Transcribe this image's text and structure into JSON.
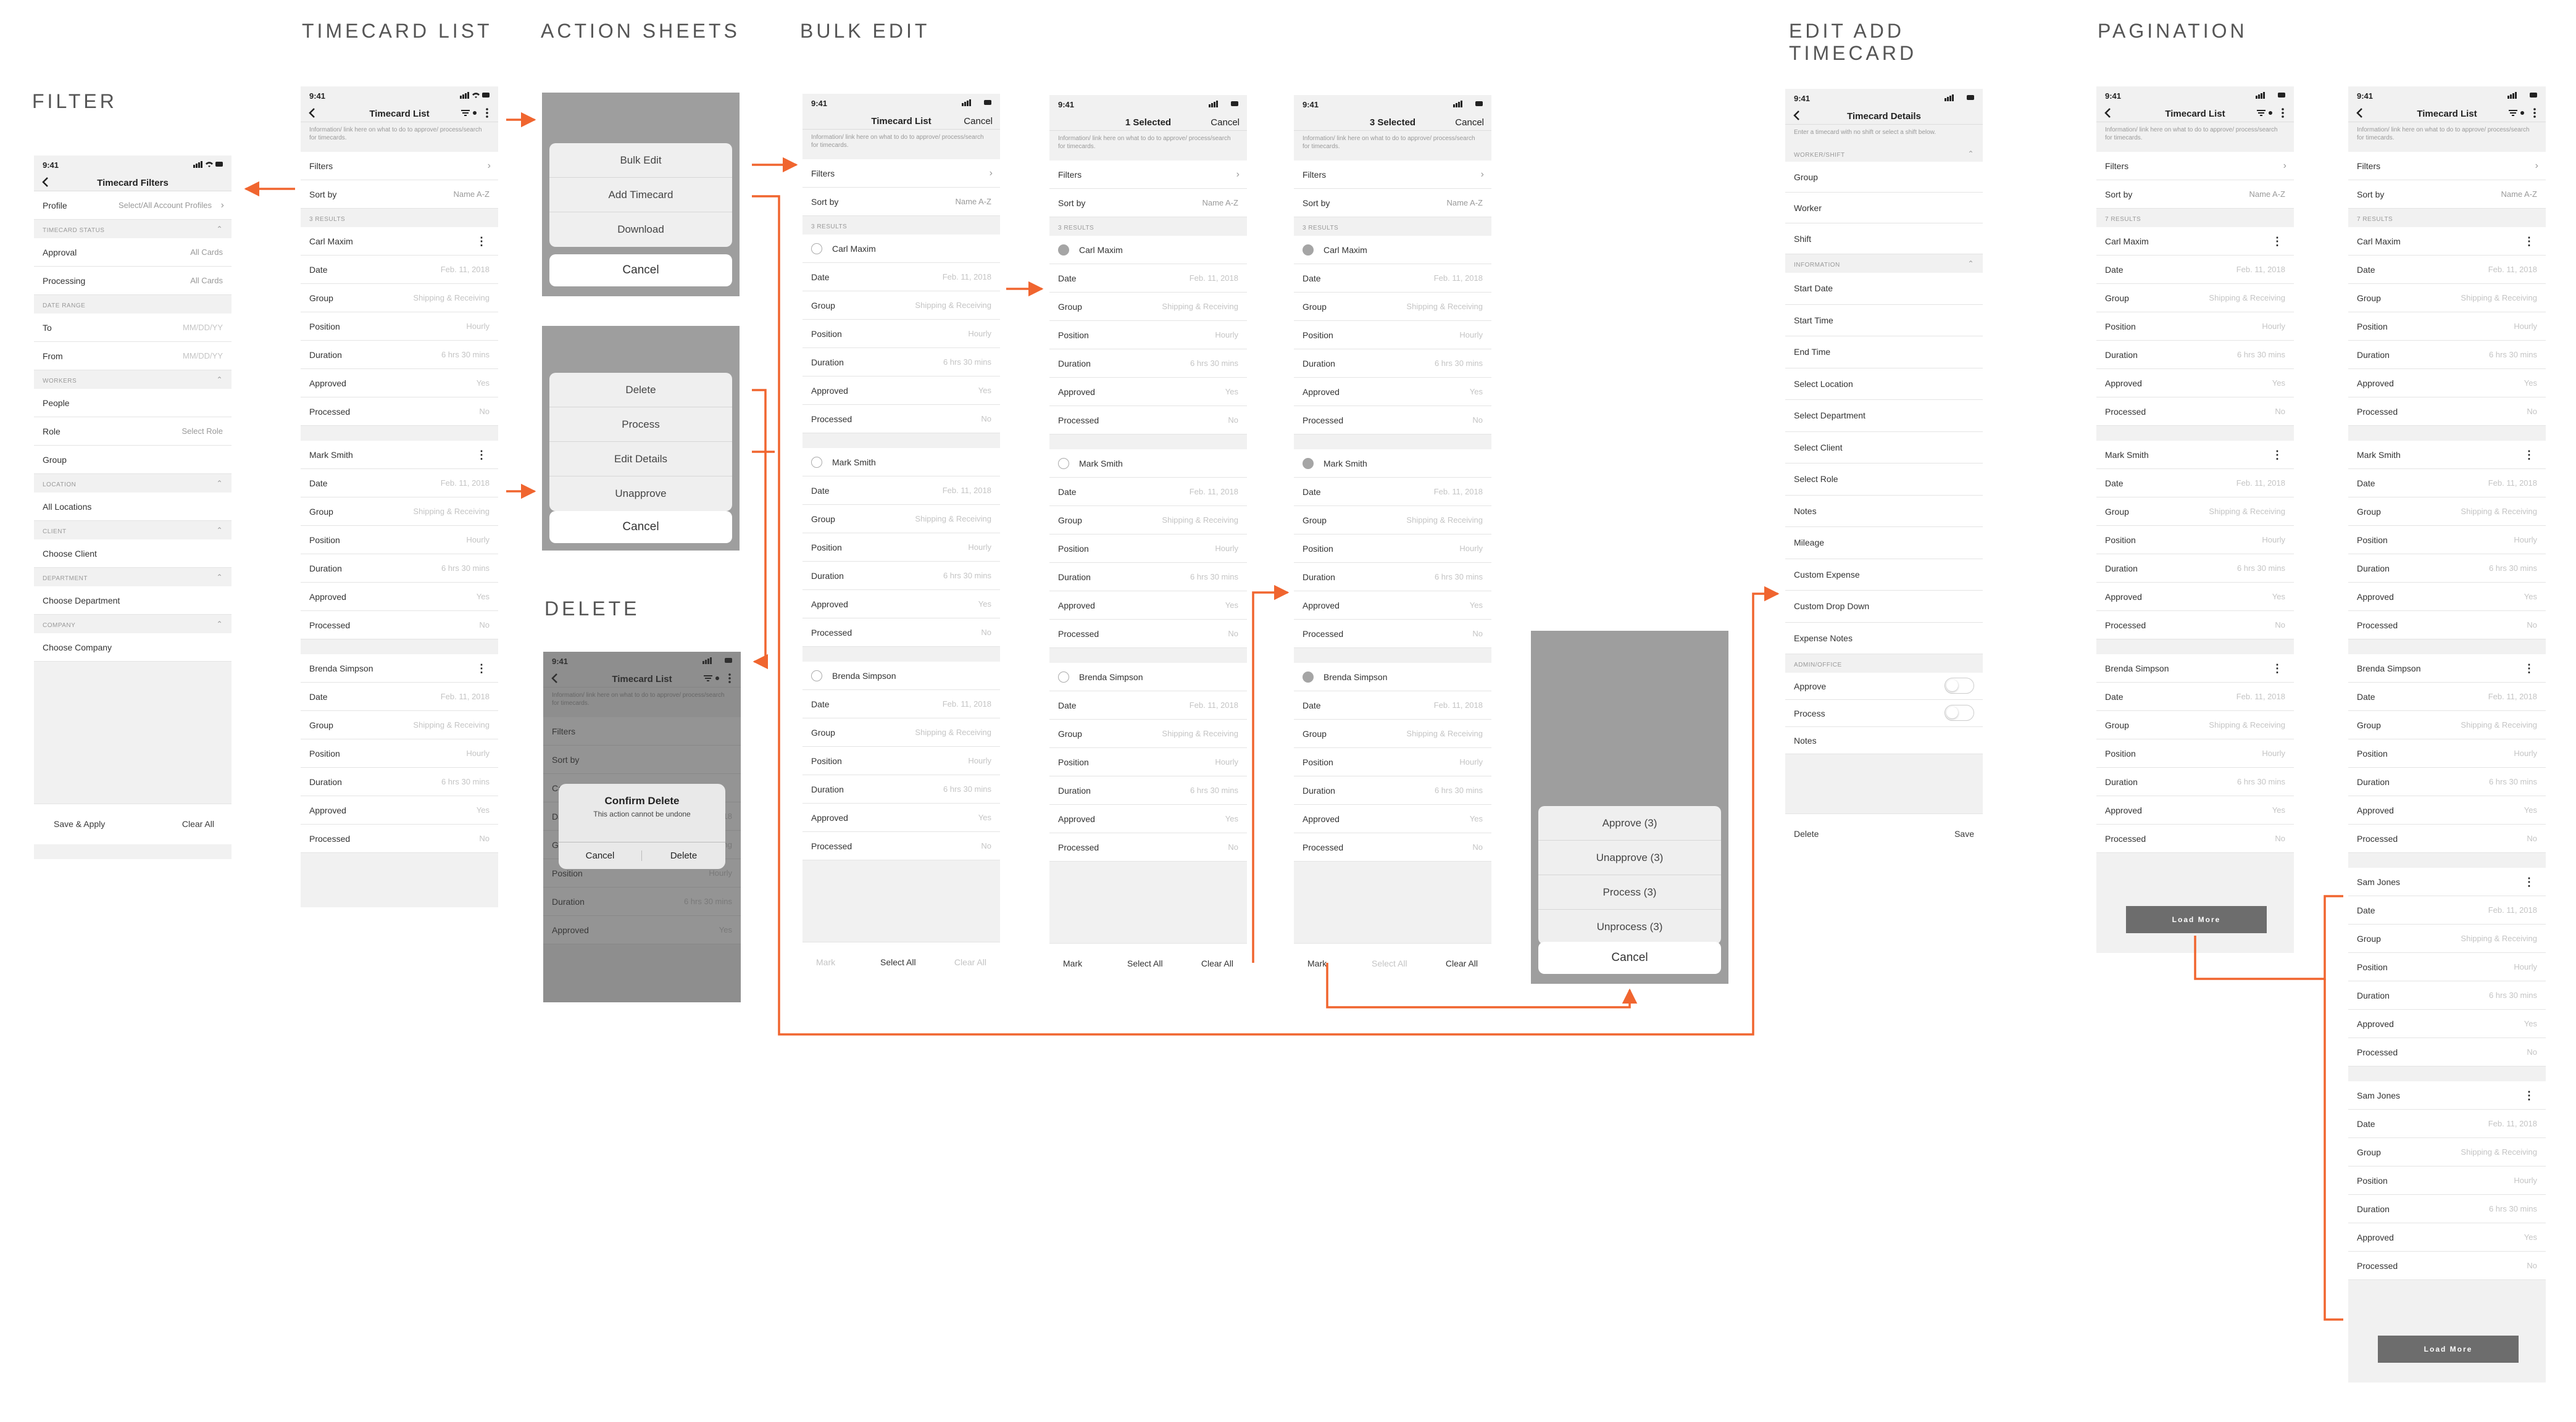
{
  "sections": {
    "filter": "FILTER",
    "timecard_list": "TIMECARD LIST",
    "action_sheets": "ACTION SHEETS",
    "bulk_edit": "BULK EDIT",
    "delete": "DELETE",
    "edit_add_1": "EDIT ADD",
    "edit_add_2": "TIMECARD",
    "pagination": "PAGINATION"
  },
  "common": {
    "time": "9:41",
    "info_text": "Information/ link here on what to do to approve/ process/search for timecards.",
    "filters": "Filters",
    "sort_by": "Sort by",
    "sort_value": "Name A-Z",
    "results_3": "3 RESULTS",
    "results_7": "7 RESULTS",
    "timecard_list": "Timecard List",
    "cancel": "Cancel",
    "fields": {
      "date": "Date",
      "group": "Group",
      "position": "Position",
      "duration": "Duration",
      "approved": "Approved",
      "processed": "Processed"
    },
    "values": {
      "date": "Feb. 11, 2018",
      "group": "Shipping & Receiving",
      "position": "Hourly",
      "duration": "6 hrs 30 mins",
      "approved": "Yes",
      "processed": "No"
    },
    "workers": {
      "carl": "Carl Maxim",
      "mark": "Mark Smith",
      "brenda": "Brenda Simpson",
      "sam": "Sam Jones"
    },
    "mark": "Mark",
    "select_all": "Select All",
    "clear_all": "Clear All",
    "load_more": "Load More"
  },
  "filter_screen": {
    "title": "Timecard Filters",
    "profile_label": "Profile",
    "profile_value": "Select/All Account Profiles",
    "timecard_status": "TIMECARD STATUS",
    "approval": "Approval",
    "processing": "Processing",
    "all_cards": "All Cards",
    "date_range": "DATE RANGE",
    "to": "To",
    "from": "From",
    "date_ph": "MM/DD/YY",
    "workers": "WORKERS",
    "people": "People",
    "role": "Role",
    "select_role": "Select Role",
    "group": "Group",
    "location": "LOCATION",
    "all_locations": "All Locations",
    "client": "CLIENT",
    "choose_client": "Choose Client",
    "department": "DEPARTMENT",
    "choose_department": "Choose Department",
    "company": "COMPANY",
    "choose_company": "Choose Company",
    "save_apply": "Save & Apply",
    "clear_all": "Clear All"
  },
  "action_sheets": {
    "sheet1": [
      "Bulk Edit",
      "Add Timecard",
      "Download"
    ],
    "sheet2": [
      "Delete",
      "Process",
      "Edit Details",
      "Unapprove"
    ]
  },
  "delete_dialog": {
    "title": "Confirm Delete",
    "message": "This action cannot be undone",
    "cancel": "Cancel",
    "delete": "Delete"
  },
  "bulk": {
    "one_selected": "1 Selected",
    "three_selected": "3 Selected",
    "sheet": [
      "Approve (3)",
      "Unapprove (3)",
      "Process (3)",
      "Unprocess (3)"
    ]
  },
  "details": {
    "title": "Timecard Details",
    "info": "Enter a timecard with no shift or select a shift below.",
    "worker_shift": "WORKER/SHIFT",
    "group": "Group",
    "worker": "Worker",
    "shift": "Shift",
    "information": "INFORMATION",
    "fields": [
      "Start Date",
      "Start Time",
      "End Time",
      "Select Location",
      "Select Department",
      "Select Client",
      "Select Role",
      "Notes",
      "Mileage",
      "Custom Expense",
      "Custom Drop Down",
      "Expense Notes"
    ],
    "admin_office": "ADMIN/OFFICE",
    "approve": "Approve",
    "process": "Process",
    "notes": "Notes",
    "delete": "Delete",
    "save": "Save"
  },
  "colors": {
    "arrow": "#f0652f",
    "screen_bg": "#f1f1f1",
    "sheet_bg": "#9e9e9e"
  }
}
